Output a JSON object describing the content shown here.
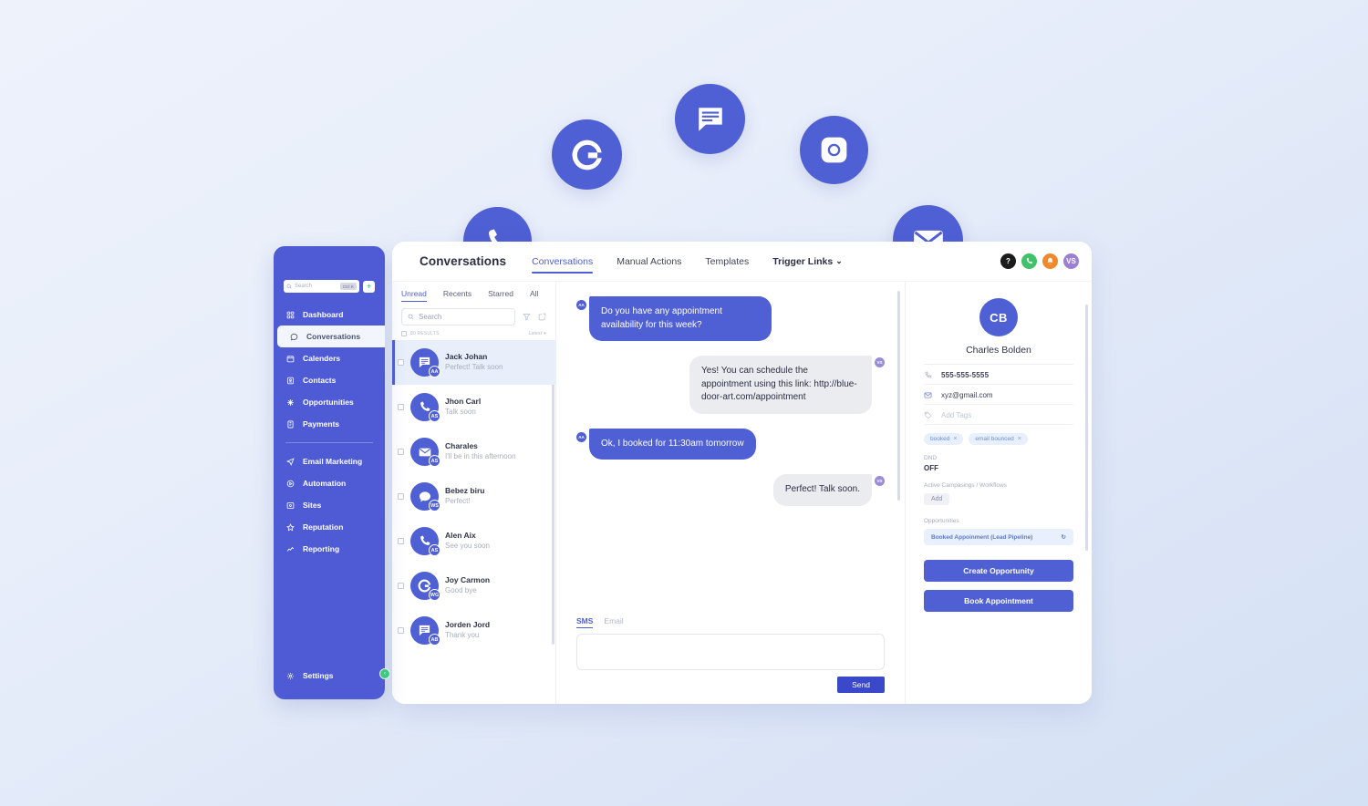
{
  "floating_icons": [
    {
      "name": "google-icon",
      "glyph": "G"
    },
    {
      "name": "chat-bubble-icon",
      "glyph": "chat"
    },
    {
      "name": "instagram-icon",
      "glyph": "camera"
    },
    {
      "name": "phone-icon",
      "glyph": "phone"
    },
    {
      "name": "email-icon",
      "glyph": "envelope"
    }
  ],
  "colors": {
    "brand_blue": "#4f5fd4",
    "sidebar_blue": "#4f5bd5",
    "send_blue": "#3a49c9",
    "tag_blue_bg": "#e8f0fe",
    "active_row_bg": "#e8effb",
    "out_bubble_bg": "#ebecef",
    "green_accent": "#3fc97f",
    "page_bg_top": "#eef2fb",
    "page_bg_bottom": "#d4e0f4"
  },
  "topbar": {
    "title": "Conversations",
    "tabs": [
      {
        "label": "Conversations",
        "active": true
      },
      {
        "label": "Manual Actions",
        "active": false
      },
      {
        "label": "Templates",
        "active": false
      },
      {
        "label": "Trigger Links",
        "active": false,
        "caret": "⌄"
      }
    ],
    "right_badges": [
      {
        "name": "help-icon",
        "label": "?",
        "color": "#1b1b1b"
      },
      {
        "name": "whatsapp-icon",
        "label": "",
        "color": "#41c16a"
      },
      {
        "name": "notification-bell-icon",
        "label": "",
        "color": "#f0882c"
      },
      {
        "name": "user-avatar",
        "label": "VS",
        "color": "#9b7fd4"
      }
    ]
  },
  "sidebar": {
    "search": {
      "placeholder": "Search",
      "shortcut": "Ctrl K"
    },
    "add_label": "+",
    "items": [
      {
        "label": "Dashboard",
        "icon": "dashboard-icon",
        "active": false
      },
      {
        "label": "Conversations",
        "icon": "chat-icon",
        "active": true
      },
      {
        "label": "Calenders",
        "icon": "calendar-icon",
        "active": false
      },
      {
        "label": "Contacts",
        "icon": "contacts-icon",
        "active": false
      },
      {
        "label": "Opportunities",
        "icon": "opportunities-icon",
        "active": false
      },
      {
        "label": "Payments",
        "icon": "payments-icon",
        "active": false
      }
    ],
    "items2": [
      {
        "label": "Email Marketing",
        "icon": "send-icon",
        "active": false
      },
      {
        "label": "Automation",
        "icon": "automation-icon",
        "active": false
      },
      {
        "label": "Sites",
        "icon": "sites-icon",
        "active": false
      },
      {
        "label": "Reputation",
        "icon": "star-icon",
        "active": false
      },
      {
        "label": "Reporting",
        "icon": "reporting-icon",
        "active": false
      }
    ],
    "settings": {
      "label": "Settings",
      "icon": "gear-icon"
    },
    "collapse_label": "‹"
  },
  "conversation_list": {
    "filters": [
      {
        "label": "Unread",
        "active": true
      },
      {
        "label": "Recents",
        "active": false
      },
      {
        "label": "Starred",
        "active": false
      },
      {
        "label": "All",
        "active": false
      }
    ],
    "search_placeholder": "Search",
    "results_label": "80 RESULTS",
    "sort_label": "Latest",
    "items": [
      {
        "name": "Jack Johan",
        "preview": "Perfect! Talk soon",
        "badge": "AA",
        "channel": "chat-icon",
        "active": true
      },
      {
        "name": "Jhon Carl",
        "preview": "Talk soon",
        "badge": "AS",
        "channel": "phone-icon",
        "active": false
      },
      {
        "name": "Charales",
        "preview": "I'll be in this afternoon",
        "badge": "AS",
        "channel": "email-icon",
        "active": false
      },
      {
        "name": "Bebez biru",
        "preview": "Perfect!",
        "badge": "WS",
        "channel": "bubble-icon",
        "active": false
      },
      {
        "name": "Alen Aix",
        "preview": "See you soon",
        "badge": "AS",
        "channel": "phone-icon",
        "active": false
      },
      {
        "name": "Joy Carmon",
        "preview": "Good bye",
        "badge": "WG",
        "channel": "google-icon",
        "active": false
      },
      {
        "name": "Jorden Jord",
        "preview": "Thank you",
        "badge": "AB",
        "channel": "chat-icon",
        "active": false
      }
    ]
  },
  "chat": {
    "messages": [
      {
        "dir": "in",
        "badge": "AA",
        "text": "Do you have any appointment availability for this week?"
      },
      {
        "dir": "out",
        "badge": "VS",
        "text": "Yes! You can schedule the appointment using this link: http://blue-door-art.com/appointment"
      },
      {
        "dir": "in",
        "badge": "AA",
        "text": "Ok, I booked for 11:30am tomorrow"
      },
      {
        "dir": "out",
        "badge": "VS",
        "text": "Perfect! Talk soon."
      }
    ],
    "composer": {
      "tabs": [
        {
          "label": "SMS",
          "active": true
        },
        {
          "label": "Email",
          "active": false
        }
      ],
      "value": "",
      "placeholder": "",
      "send_label": "Send"
    }
  },
  "contact": {
    "initials": "CB",
    "name": "Charles Bolden",
    "phone": "555-555-5555",
    "email": "xyz@gmail.com",
    "tags_placeholder": "Add Tags",
    "tags": [
      {
        "label": "booked",
        "remove": "×"
      },
      {
        "label": "email bounced",
        "remove": "×"
      }
    ],
    "dnd_label": "DND",
    "dnd_value": "OFF",
    "campaigns_label": "Active Campasings / Workflows",
    "campaigns_add": "Add",
    "opportunities_label": "Opportunities",
    "opportunity": {
      "label": "Booked Appoinment (Lead Pipeline)",
      "action": "↻"
    },
    "create_opportunity_label": "Create Opportunity",
    "book_appointment_label": "Book Appointment"
  }
}
